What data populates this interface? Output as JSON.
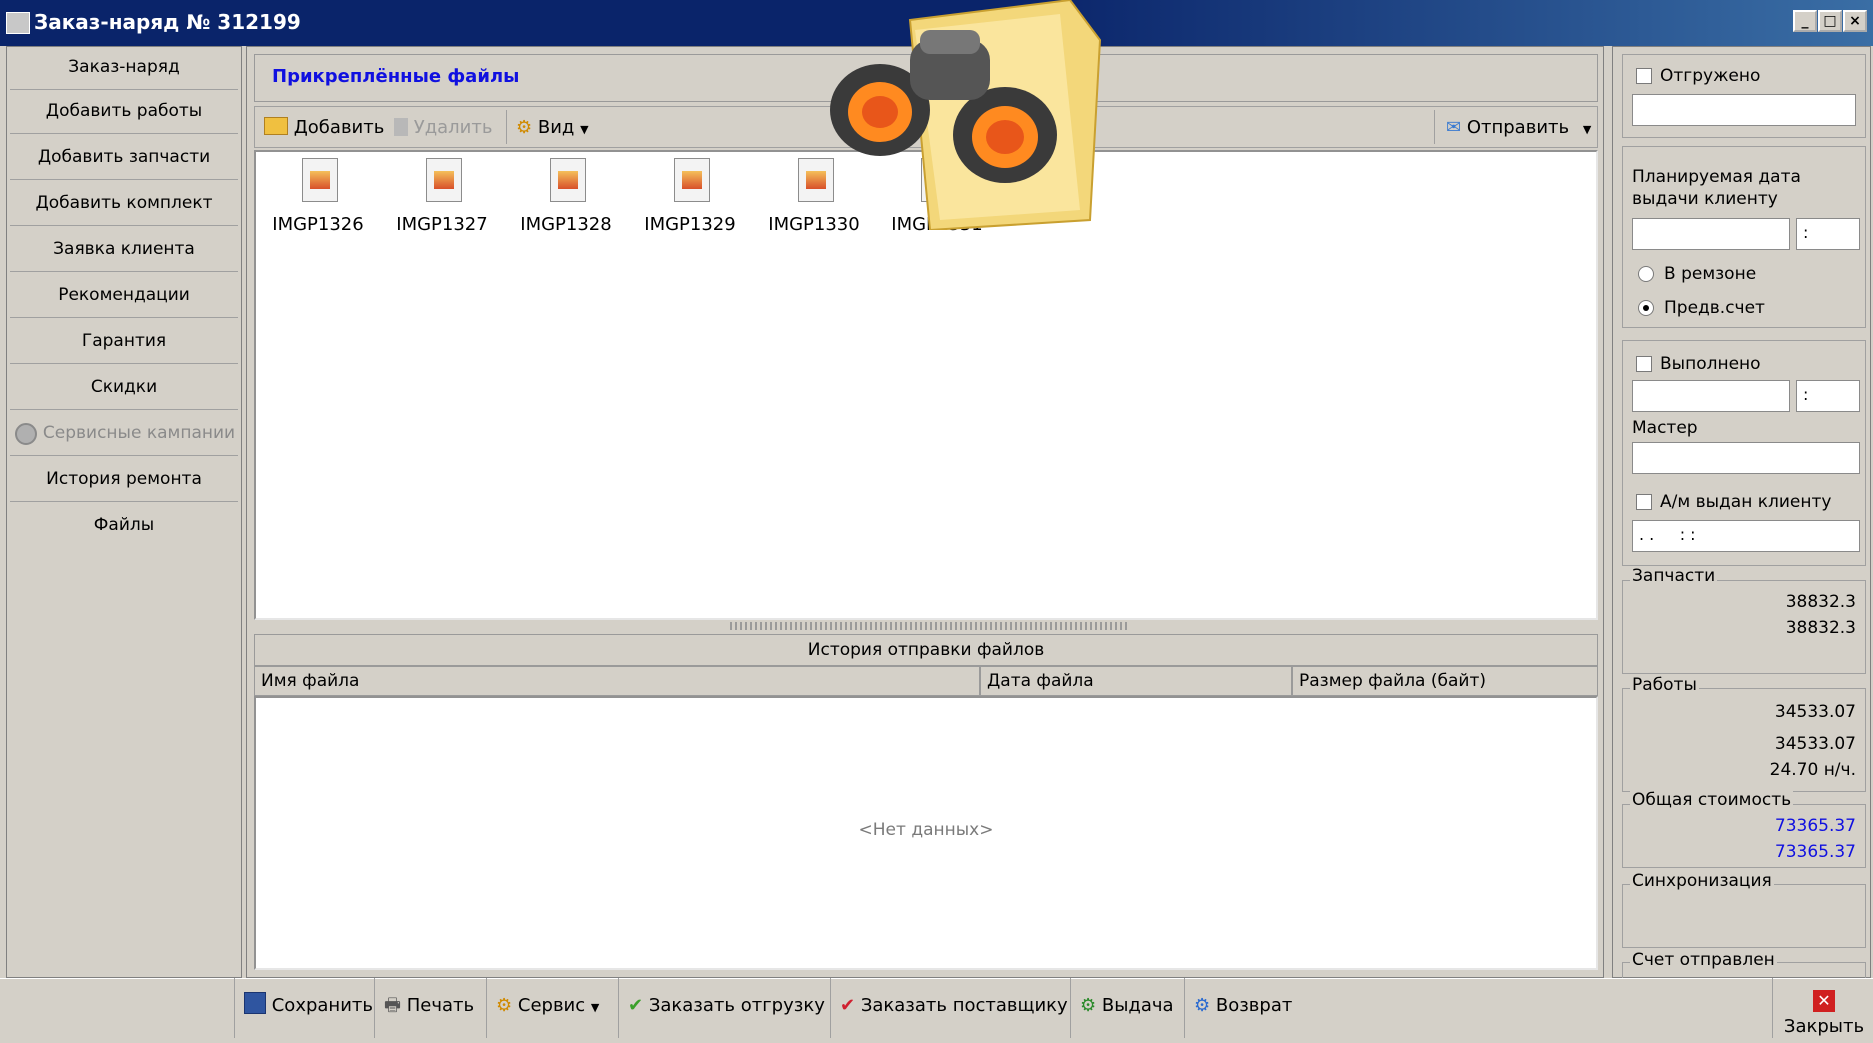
{
  "window": {
    "title": "Заказ-наряд № 312199"
  },
  "sidebar": {
    "items": [
      {
        "label": "Заказ-наряд"
      },
      {
        "label": "Добавить работы"
      },
      {
        "label": "Добавить запчасти"
      },
      {
        "label": "Добавить комплект"
      },
      {
        "label": "Заявка клиента"
      },
      {
        "label": "Рекомендации"
      },
      {
        "label": "Гарантия"
      },
      {
        "label": "Скидки"
      },
      {
        "label": "Сервисные кампании"
      },
      {
        "label": "История ремонта"
      },
      {
        "label": "Файлы"
      }
    ]
  },
  "files_panel": {
    "title": "Прикреплённые файлы",
    "toolbar": {
      "add": "Добавить",
      "delete": "Удалить",
      "view": "Вид",
      "send": "Отправить"
    },
    "files": [
      {
        "name": "IMGP1326"
      },
      {
        "name": "IMGP1327"
      },
      {
        "name": "IMGP1328"
      },
      {
        "name": "IMGP1329"
      },
      {
        "name": "IMGP1330"
      },
      {
        "name": "IMGP1331"
      }
    ]
  },
  "history": {
    "title": "История отправки файлов",
    "columns": [
      "Имя файла",
      "Дата файла",
      "Размер файла (байт)"
    ],
    "empty": "<Нет данных>"
  },
  "right": {
    "shipped": "Отгружено",
    "planned_date_label": "Планируемая дата выдачи клиенту",
    "time_sep": ":",
    "radio_repair_zone": "В ремзоне",
    "radio_preinvoice": "Предв.счет",
    "done": "Выполнено",
    "master_label": "Мастер",
    "car_issued": "А/м выдан клиенту",
    "car_issued_value": ". .     : :",
    "parts": {
      "label": "Запчасти",
      "value1": "38832.3",
      "value2": "38832.3"
    },
    "works": {
      "label": "Работы",
      "value1": "34533.07",
      "value2": "34533.07",
      "hours": "24.70 н/ч."
    },
    "total": {
      "label": "Общая стоимость",
      "value1": "73365.37",
      "value2": "73365.37"
    },
    "sync": {
      "label": "Синхронизация"
    },
    "invoice_sent": {
      "label": "Счет отправлен"
    }
  },
  "bottom": {
    "save": "Сохранить",
    "print": "Печать",
    "service": "Сервис",
    "order_shipment": "Заказать отгрузку",
    "order_supplier": "Заказать поставщику",
    "issue": "Выдача",
    "return": "Возврат",
    "close": "Закрыть"
  },
  "colors": {
    "accent_blue": "#1010e0",
    "title_bar": "#0a246a"
  }
}
